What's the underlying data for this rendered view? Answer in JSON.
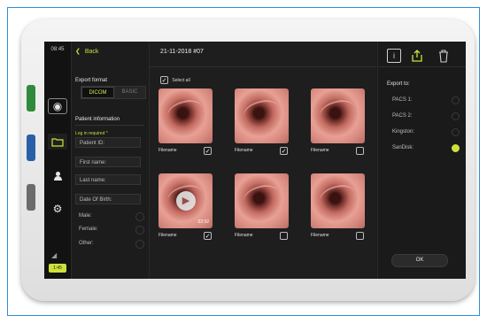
{
  "status_bar": {
    "time": "08:45",
    "battery": "1:45"
  },
  "panel": {
    "back_label": "Back",
    "export_format_title": "Export format",
    "format_options": [
      "DICOM",
      "BASIC"
    ],
    "patient_info_title": "Patient information",
    "login_required": "Log in required *",
    "fields": {
      "patient_id": "Patient ID:",
      "first_name": "First name:",
      "last_name": "Last name:",
      "date_of_birth": "Date Of Birth:"
    },
    "sex_options": [
      "Male:",
      "Female:",
      "Other:"
    ]
  },
  "gallery": {
    "title": "21-11-2018 #07",
    "select_all_label": "Select all",
    "items": [
      {
        "filename": "Filename",
        "checked": true,
        "video": false,
        "duration": ""
      },
      {
        "filename": "Filename",
        "checked": true,
        "video": false,
        "duration": ""
      },
      {
        "filename": "Filename",
        "checked": false,
        "video": false,
        "duration": ""
      },
      {
        "filename": "Filename",
        "checked": true,
        "video": true,
        "duration": "02:32"
      },
      {
        "filename": "Filename",
        "checked": false,
        "video": false,
        "duration": ""
      },
      {
        "filename": "Filename",
        "checked": false,
        "video": false,
        "duration": ""
      }
    ]
  },
  "export": {
    "title": "Export to:",
    "destinations": [
      {
        "label": "PACS 1:",
        "selected": false
      },
      {
        "label": "PACS 2:",
        "selected": false
      },
      {
        "label": "Kingston:",
        "selected": false
      },
      {
        "label": "SanDisk:",
        "selected": true
      }
    ],
    "ok_label": "OK"
  },
  "colors": {
    "accent": "#cde13a",
    "background": "#1b1b1b"
  }
}
